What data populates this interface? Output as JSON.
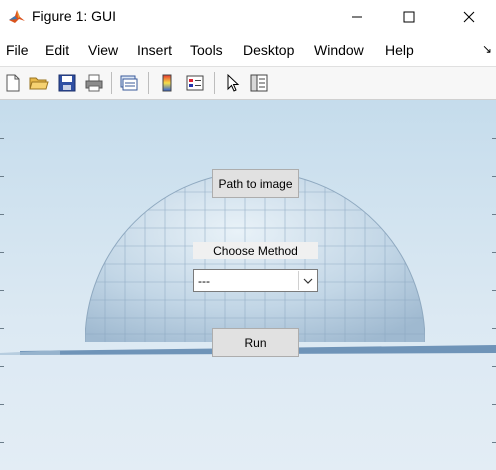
{
  "window": {
    "title": "Figure 1: GUI"
  },
  "window_controls": {
    "minimize_icon": "minimize-icon",
    "maximize_icon": "maximize-icon",
    "close_icon": "close-icon"
  },
  "menubar": {
    "items": [
      {
        "label": "File"
      },
      {
        "label": "Edit"
      },
      {
        "label": "View"
      },
      {
        "label": "Insert"
      },
      {
        "label": "Tools"
      },
      {
        "label": "Desktop"
      },
      {
        "label": "Window"
      },
      {
        "label": "Help"
      }
    ],
    "dock_arrow": "↘"
  },
  "toolbar": {
    "icons": [
      "new-figure-icon",
      "open-file-icon",
      "save-icon",
      "print-icon",
      "link-figure-icon",
      "colorbar-icon",
      "legend-icon",
      "pointer-icon",
      "property-inspector-icon"
    ]
  },
  "gui": {
    "path_button": "Path to image",
    "method_label": "Choose Method",
    "method_select": {
      "value": "---"
    },
    "run_button": "Run"
  }
}
